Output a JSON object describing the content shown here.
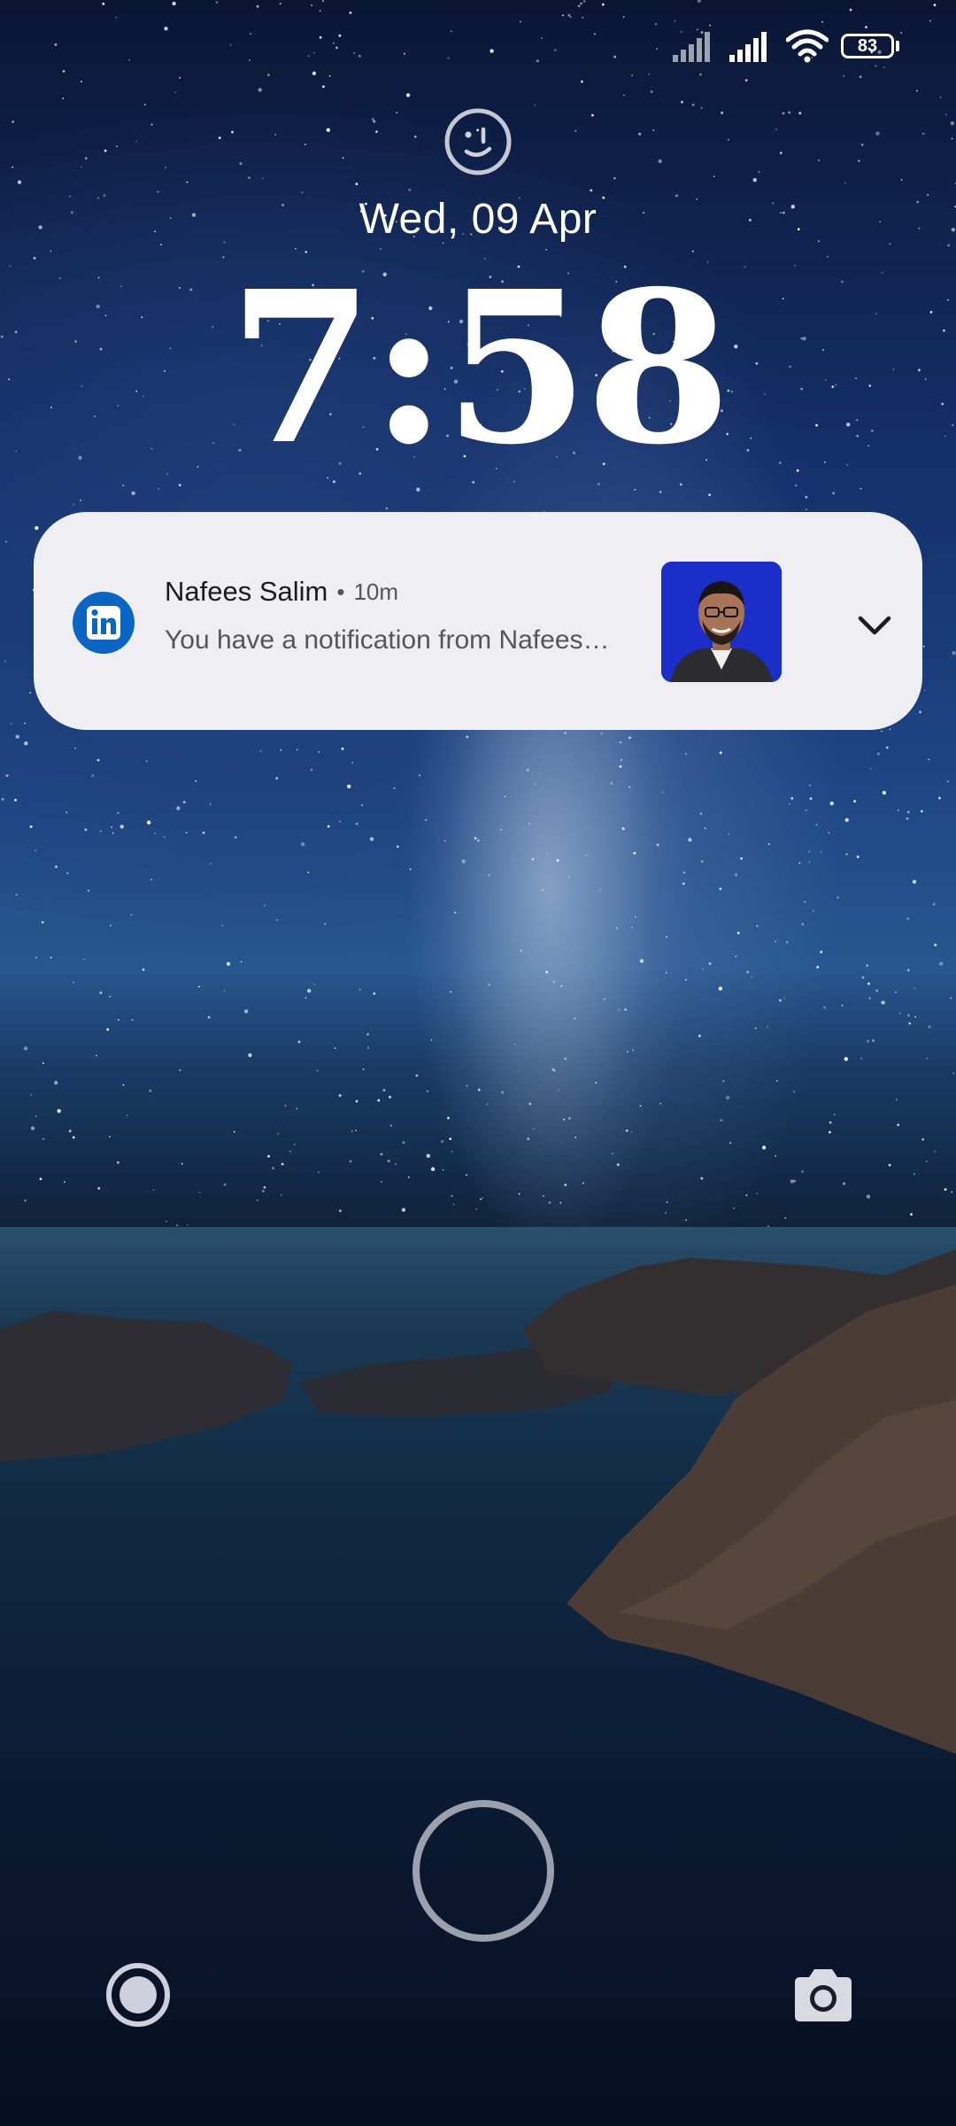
{
  "status_bar": {
    "battery_level": "83",
    "icons": [
      "signal-sim1-icon",
      "signal-sim2-icon",
      "wifi-icon",
      "battery-icon"
    ]
  },
  "lock_screen": {
    "date": "Wed, 09 Apr",
    "time": "7:58"
  },
  "notification": {
    "app_icon": "linkedin-icon",
    "title": "Nafees Salim",
    "separator": "•",
    "time_ago": "10m",
    "text": "You have a notification from Nafees…",
    "expand_icon": "chevron-down-icon"
  },
  "shortcuts": {
    "left_icon": "voice-assistant-icon",
    "right_icon": "camera-icon"
  },
  "colors": {
    "notification_bg": "#eeeef3",
    "linkedin_blue": "#0a66c2"
  }
}
